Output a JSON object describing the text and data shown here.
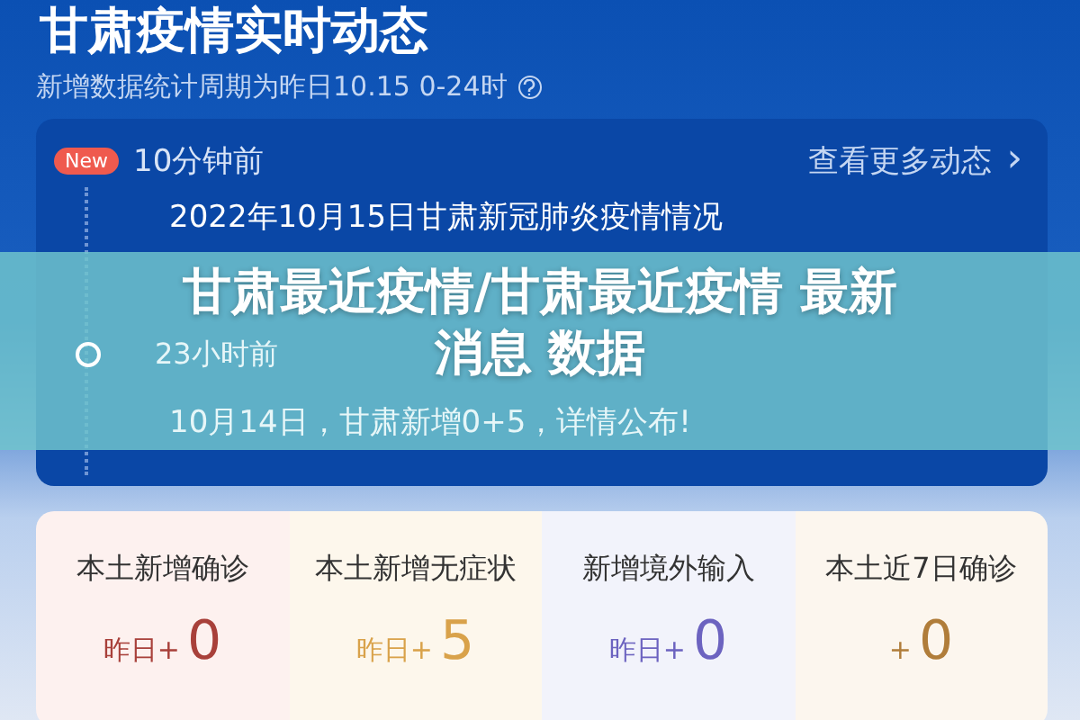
{
  "page_title": "甘肃疫情实时动态",
  "subtitle": "新增数据统计周期为昨日10.15 0-24时",
  "news": {
    "badge": "New",
    "time": "10分钟前",
    "more_link": "查看更多动态",
    "more_icon": "›",
    "entries": [
      {
        "headline": "2022年10月15日甘肃新冠肺炎疫情情况"
      },
      {
        "time": "23小时前",
        "headline": "10月14日，甘肃新增0+5，详情公布!"
      }
    ]
  },
  "banner": [
    "甘肃最近疫情/甘肃最近疫情 最新",
    "消息 数据"
  ],
  "stats": [
    {
      "label": "本土新增确诊",
      "prefix": "昨日+",
      "value": "0",
      "color": "#a8403a"
    },
    {
      "label": "本土新增无症状",
      "prefix": "昨日+",
      "value": "5",
      "color": "#d9a24a"
    },
    {
      "label": "新增境外输入",
      "prefix": "昨日+",
      "value": "0",
      "color": "#6c63c0"
    },
    {
      "label": "本土近7日确诊",
      "prefix": "+",
      "value": "0",
      "color": "#b07d3a"
    }
  ]
}
